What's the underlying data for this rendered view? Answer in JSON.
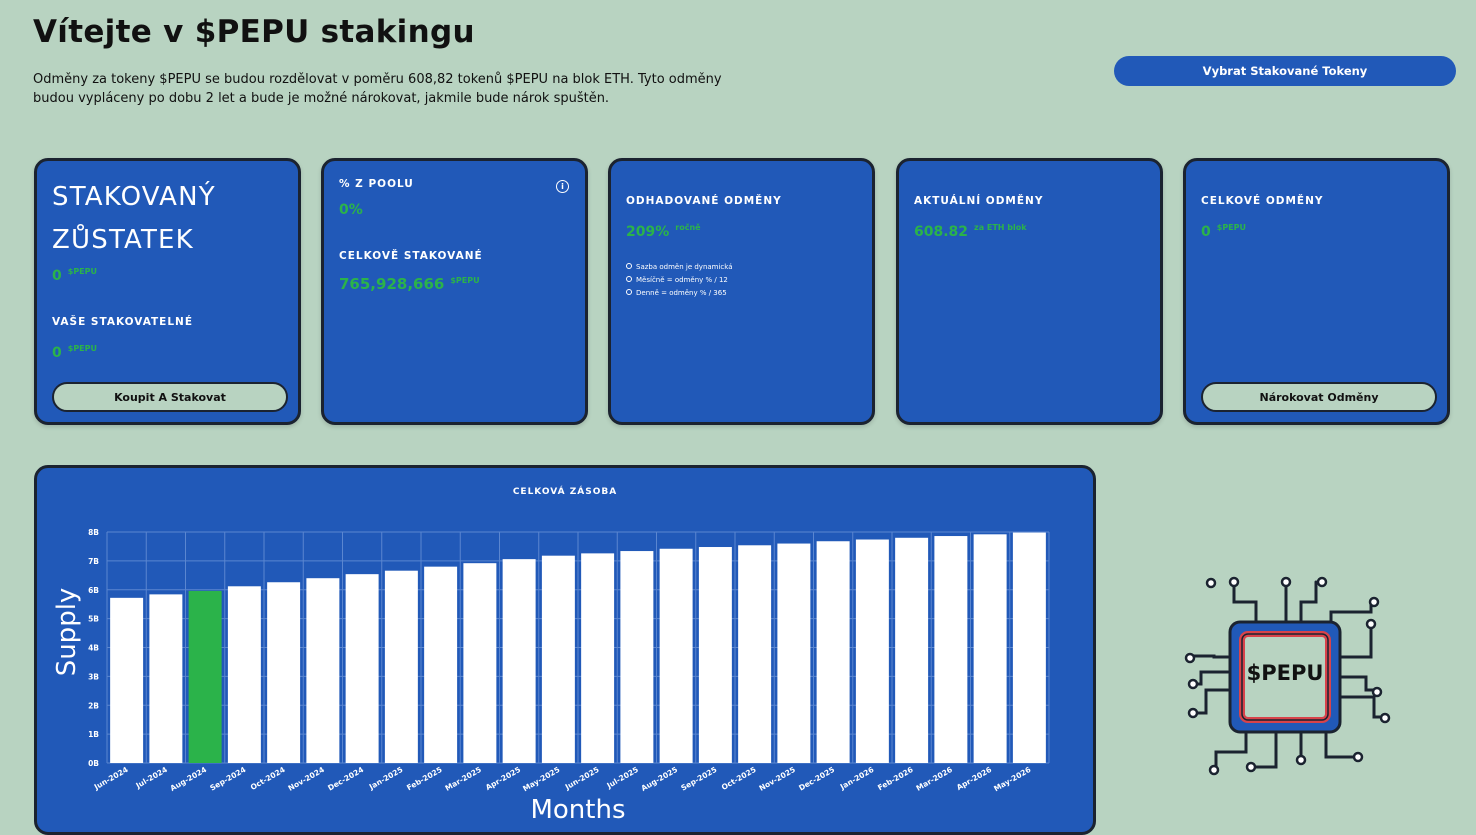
{
  "header": {
    "title": "Vítejte v $PEPU stakingu",
    "intro": "Odměny za tokeny $PEPU se budou rozdělovat v poměru 608,82 tokenů $PEPU na blok ETH. Tyto odměny budou vypláceny po dobu 2 let a bude je možné nárokovat, jakmile bude nárok spuštěn.",
    "unstake_button": "Vybrat Stakované Tokeny"
  },
  "cards": {
    "staked": {
      "title_line1": "STAKOVANÝ",
      "title_line2": "ZŮSTATEK",
      "value": "0",
      "unit": "$PEPU",
      "stakeable_label": "VAŠE STAKOVATELNÉ",
      "stakeable_value": "0",
      "stakeable_unit": "$PEPU",
      "button": "Koupit A Stakovat"
    },
    "pool": {
      "pool_label": "% Z POOLU",
      "pool_value": "0%",
      "total_label": "CELKOVĚ STAKOVANÉ",
      "total_value": "765,928,666",
      "total_unit": "$PEPU",
      "info_icon": "info-icon"
    },
    "estimated": {
      "label": "ODHADOVANÉ ODMĚNY",
      "value": "209%",
      "unit": "ročně",
      "notes": [
        "Sazba odměn je dynamická",
        "Měsíčně = odměny % / 12",
        "Denně = odměny % / 365"
      ]
    },
    "current": {
      "label": "AKTUÁLNÍ ODMĚNY",
      "value": "608.82",
      "unit": "za ETH blok"
    },
    "total": {
      "label": "CELKOVÉ ODMĚNY",
      "value": "0",
      "unit": "$PEPU",
      "button": "Nárokovat Odměny"
    }
  },
  "logo": {
    "text": "$PEPU",
    "icon": "chip-icon"
  },
  "colors": {
    "background": "#b8d3c1",
    "card": "#2159b8",
    "accent_green": "#2bb34a",
    "border": "#1b2330"
  },
  "chart_data": {
    "type": "bar",
    "title": "CELKOVÁ ZÁSOBA",
    "xlabel": "Months",
    "ylabel": "Supply",
    "ylim": [
      0,
      8
    ],
    "yticks": [
      "0B",
      "1B",
      "2B",
      "3B",
      "4B",
      "5B",
      "6B",
      "7B",
      "8B"
    ],
    "categories": [
      "Jun-2024",
      "Jul-2024",
      "Aug-2024",
      "Sep-2024",
      "Oct-2024",
      "Nov-2024",
      "Dec-2024",
      "Jan-2025",
      "Feb-2025",
      "Mar-2025",
      "Apr-2025",
      "May-2025",
      "Jun-2025",
      "Jul-2025",
      "Aug-2025",
      "Sep-2025",
      "Oct-2025",
      "Nov-2025",
      "Dec-2025",
      "Jan-2026",
      "Feb-2026",
      "Mar-2026",
      "Apr-2026",
      "May-2026"
    ],
    "values": [
      5.72,
      5.84,
      5.96,
      6.12,
      6.26,
      6.4,
      6.54,
      6.66,
      6.8,
      6.92,
      7.06,
      7.18,
      7.26,
      7.34,
      7.42,
      7.48,
      7.54,
      7.6,
      7.68,
      7.74,
      7.8,
      7.86,
      7.92,
      7.98
    ],
    "highlight_index": 2,
    "bar_color": "#ffffff",
    "highlight_color": "#2bb34a",
    "grid": true
  }
}
